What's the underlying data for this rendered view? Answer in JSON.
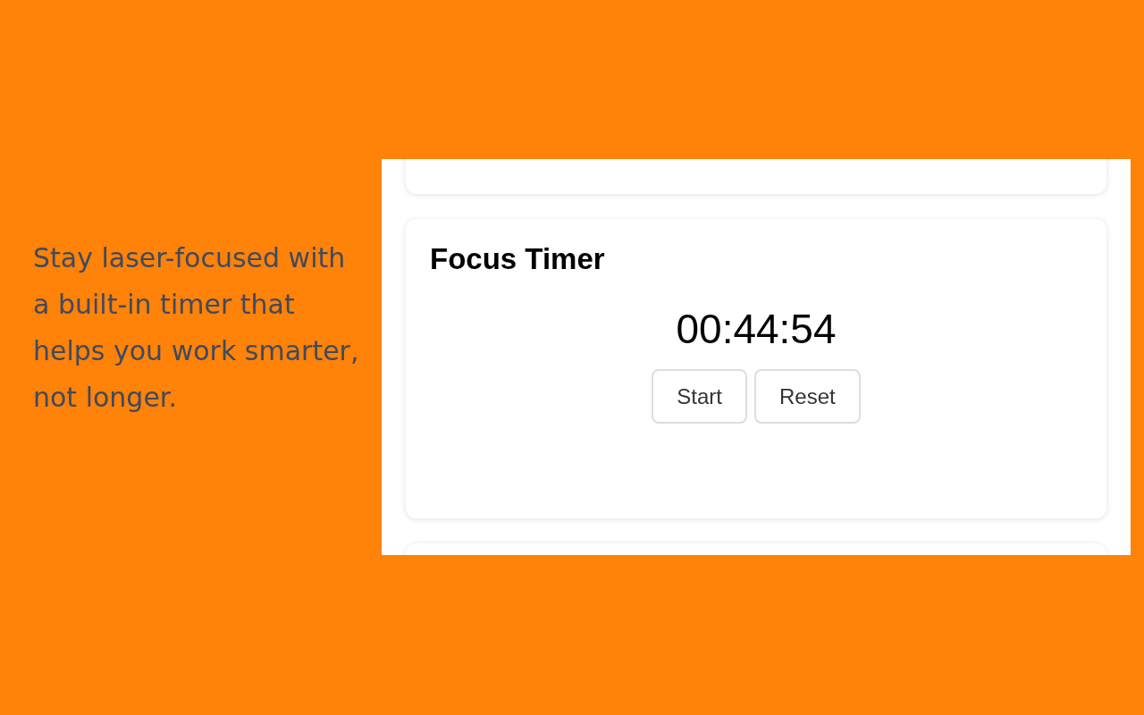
{
  "tagline": "Stay laser-focused with a built-in timer that helps you work smarter, not longer.",
  "timer_card": {
    "title": "Focus Timer",
    "time": "00:44:54",
    "buttons": [
      "Start",
      "Reset"
    ]
  }
}
